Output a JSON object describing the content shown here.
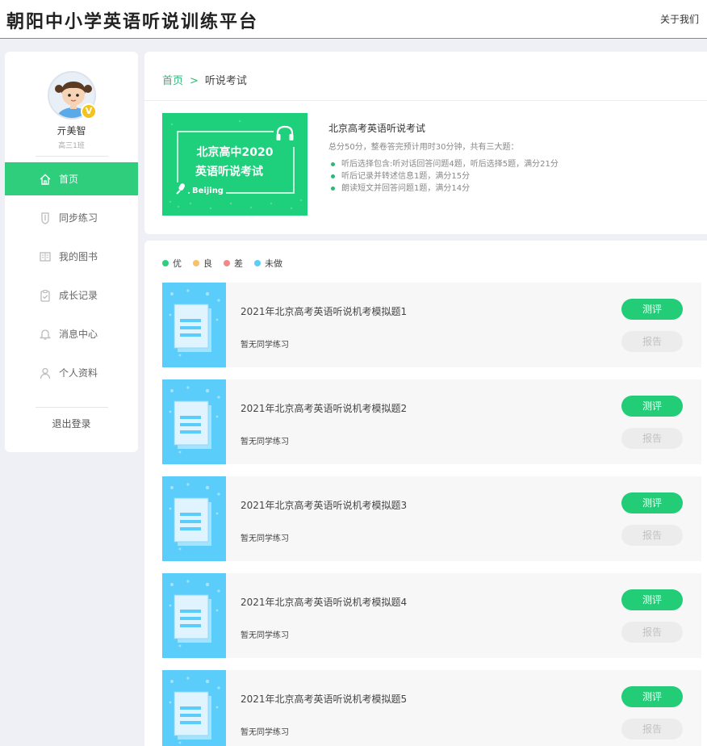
{
  "header": {
    "brand": "朝阳中小学英语听说训练平台",
    "about_link": "关于我们"
  },
  "user": {
    "name": "亓美智",
    "class": "高三1班",
    "badge": "V"
  },
  "nav": [
    {
      "label": "首页",
      "icon": "home-icon",
      "active": true
    },
    {
      "label": "同步练习",
      "icon": "shield-icon",
      "active": false
    },
    {
      "label": "我的图书",
      "icon": "book-icon",
      "active": false
    },
    {
      "label": "成长记录",
      "icon": "clipboard-check-icon",
      "active": false
    },
    {
      "label": "消息中心",
      "icon": "bell-icon",
      "active": false
    },
    {
      "label": "个人资料",
      "icon": "user-icon",
      "active": false
    }
  ],
  "logout_label": "退出登录",
  "breadcrumb": {
    "home": "首页",
    "separator": ">",
    "current": "听说考试"
  },
  "banner": {
    "line1": "北京高中2020",
    "line2": "英语听说考试",
    "city": "Beijing"
  },
  "exam": {
    "title": "北京高考英语听说考试",
    "description": "总分50分，整卷答完预计用时30分钟，共有三大题：",
    "parts": [
      "听后选择包含:听对话回答问题4题，听后选择5题，满分21分",
      "听后记录并转述信息1题，满分15分",
      "朗读短文并回答问题1题，满分14分"
    ]
  },
  "legend": [
    {
      "label": "优",
      "color": "#2fce7d"
    },
    {
      "label": "良",
      "color": "#f5c16c"
    },
    {
      "label": "差",
      "color": "#f08a8a"
    },
    {
      "label": "未做",
      "color": "#5bcdfb"
    }
  ],
  "exams_list": [
    {
      "title": "2021年北京高考英语听说机考模拟题1",
      "status": "暂无同学练习",
      "test_label": "测评",
      "report_label": "报告"
    },
    {
      "title": "2021年北京高考英语听说机考模拟题2",
      "status": "暂无同学练习",
      "test_label": "测评",
      "report_label": "报告"
    },
    {
      "title": "2021年北京高考英语听说机考模拟题3",
      "status": "暂无同学练习",
      "test_label": "测评",
      "report_label": "报告"
    },
    {
      "title": "2021年北京高考英语听说机考模拟题4",
      "status": "暂无同学练习",
      "test_label": "测评",
      "report_label": "报告"
    },
    {
      "title": "2021年北京高考英语听说机考模拟题5",
      "status": "暂无同学练习",
      "test_label": "测评",
      "report_label": "报告"
    }
  ],
  "colors": {
    "accent": "#2fce7d",
    "header_line": "#2fb874",
    "thumb": "#5bcdfb"
  }
}
